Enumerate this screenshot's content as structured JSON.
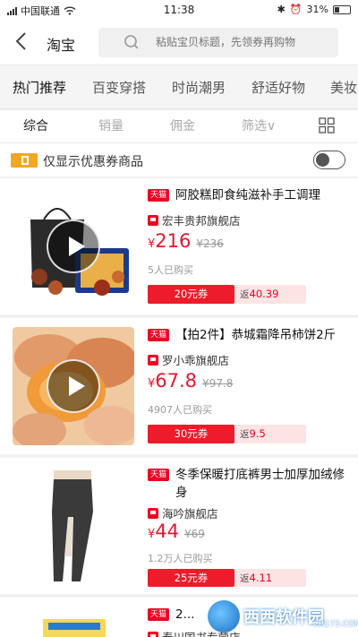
{
  "status_bar": {
    "carrier": "中国联通",
    "time": "11:38",
    "battery": "31%"
  },
  "nav": {
    "back_icon": "chevron-left-icon",
    "title": "淘宝",
    "search_placeholder": "粘贴宝贝标题，先领券再购物"
  },
  "tabs": [
    {
      "label": "热门推荐",
      "active": true
    },
    {
      "label": "百变穿搭",
      "active": false
    },
    {
      "label": "时尚潮男",
      "active": false
    },
    {
      "label": "舒适好物",
      "active": false
    },
    {
      "label": "美妆",
      "active": false
    }
  ],
  "sort": {
    "items": [
      "综合",
      "销量",
      "佣金",
      "筛选∨"
    ],
    "active_index": 0
  },
  "coupon_filter": {
    "label": "仅显示优惠券商品",
    "enabled": false
  },
  "products": [
    {
      "badge": "天猫",
      "title": "阿胶糕即食纯滋补手工调理",
      "shop": "宏丰贵邦旗舰店",
      "price": "216",
      "price_symbol": "¥",
      "orig_price": "¥236",
      "sold": "5人已购买",
      "coupon": "20元券",
      "rebate_label": "返",
      "rebate": "40.39"
    },
    {
      "badge": "天猫",
      "title": "【拍2件】恭城霜降吊柿饼2斤",
      "shop": "罗小乖旗舰店",
      "price": "67.8",
      "price_symbol": "¥",
      "orig_price": "¥97.8",
      "sold": "4907人已购买",
      "coupon": "30元券",
      "rebate_label": "返",
      "rebate": "9.5"
    },
    {
      "badge": "天猫",
      "title": "冬季保暖打底裤男士加厚加绒修身",
      "shop": "海吟旗舰店",
      "price": "44",
      "price_symbol": "¥",
      "orig_price": "¥69",
      "sold": "1.2万人已购买",
      "coupon": "25元券",
      "rebate_label": "返",
      "rebate": "4.11"
    },
    {
      "badge": "天猫",
      "title": "2...",
      "shop": "春川国书专营店",
      "price": "",
      "price_symbol": "",
      "orig_price": "",
      "sold": "",
      "coupon": "",
      "rebate_label": "",
      "rebate": ""
    }
  ],
  "watermark": {
    "text": "西西软件园",
    "sub": "CR173.COM"
  },
  "colors": {
    "accent": "#e8142c",
    "coupon_bg": "#ee1c2a",
    "rebate_bg": "#fde4e4",
    "tmall": "#ee0022"
  }
}
